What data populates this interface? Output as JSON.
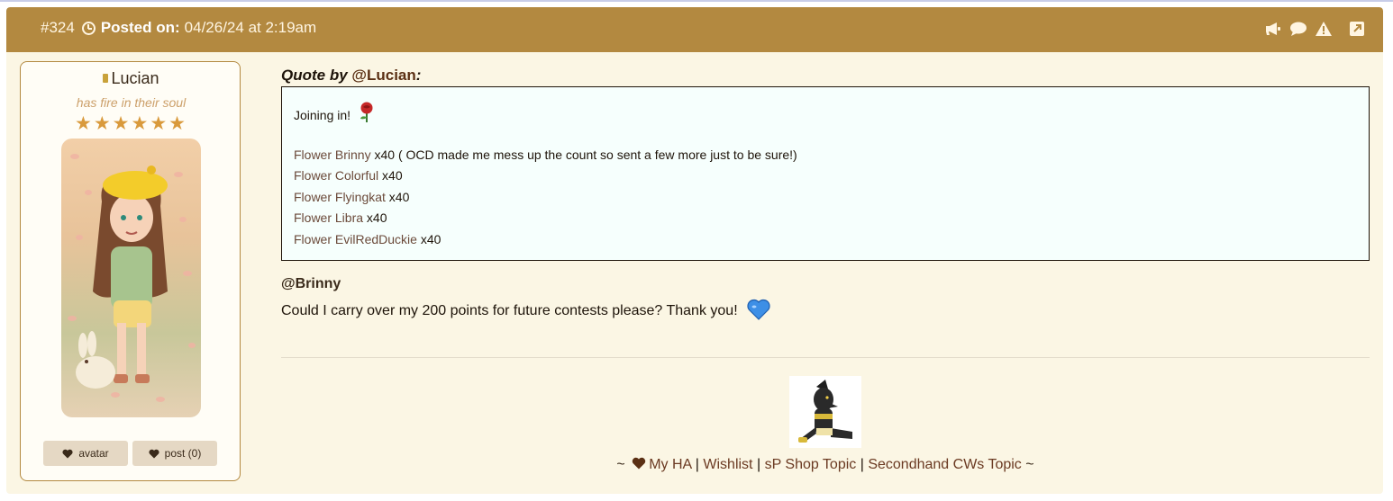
{
  "post": {
    "number": "#324",
    "posted_label": "Posted on:",
    "posted_date": "04/26/24 at 2:19am",
    "header_icons": [
      "megaphone-icon",
      "speech-bubble-icon",
      "warning-icon",
      "external-link-icon"
    ],
    "header_color": "#b38940",
    "background_color": "#fbf6e4"
  },
  "author": {
    "name": "Lucian",
    "title": "has fire in their soul",
    "stars": 6,
    "avatar_button": "avatar",
    "post_button": "post (0)"
  },
  "quote": {
    "by_prefix": "Quote by",
    "by_user": "@Lucian",
    "by_suffix": ":",
    "intro": "Joining in!",
    "intro_emoji": "rose-emoji",
    "lines": [
      {
        "link": "Flower Brinny",
        "text": " x40 ( OCD made me mess up the count so sent a few more just to be sure!)"
      },
      {
        "link": "Flower Colorful",
        "text": " x40"
      },
      {
        "link": "Flower Flyingkat",
        "text": " x40"
      },
      {
        "link": "Flower Libra",
        "text": " x40"
      },
      {
        "link": "Flower EvilRedDuckie",
        "text": " x40"
      }
    ]
  },
  "reply": {
    "mention": "@Brinny",
    "text": "Could I carry over my 200 points for future contests please? Thank you!",
    "emoji": "blue-heart-emoji"
  },
  "signature": {
    "prefix": "~",
    "links": [
      "My HA",
      "Wishlist",
      "sP Shop Topic",
      "Secondhand CWs Topic"
    ],
    "separator": "|",
    "suffix": "~"
  }
}
